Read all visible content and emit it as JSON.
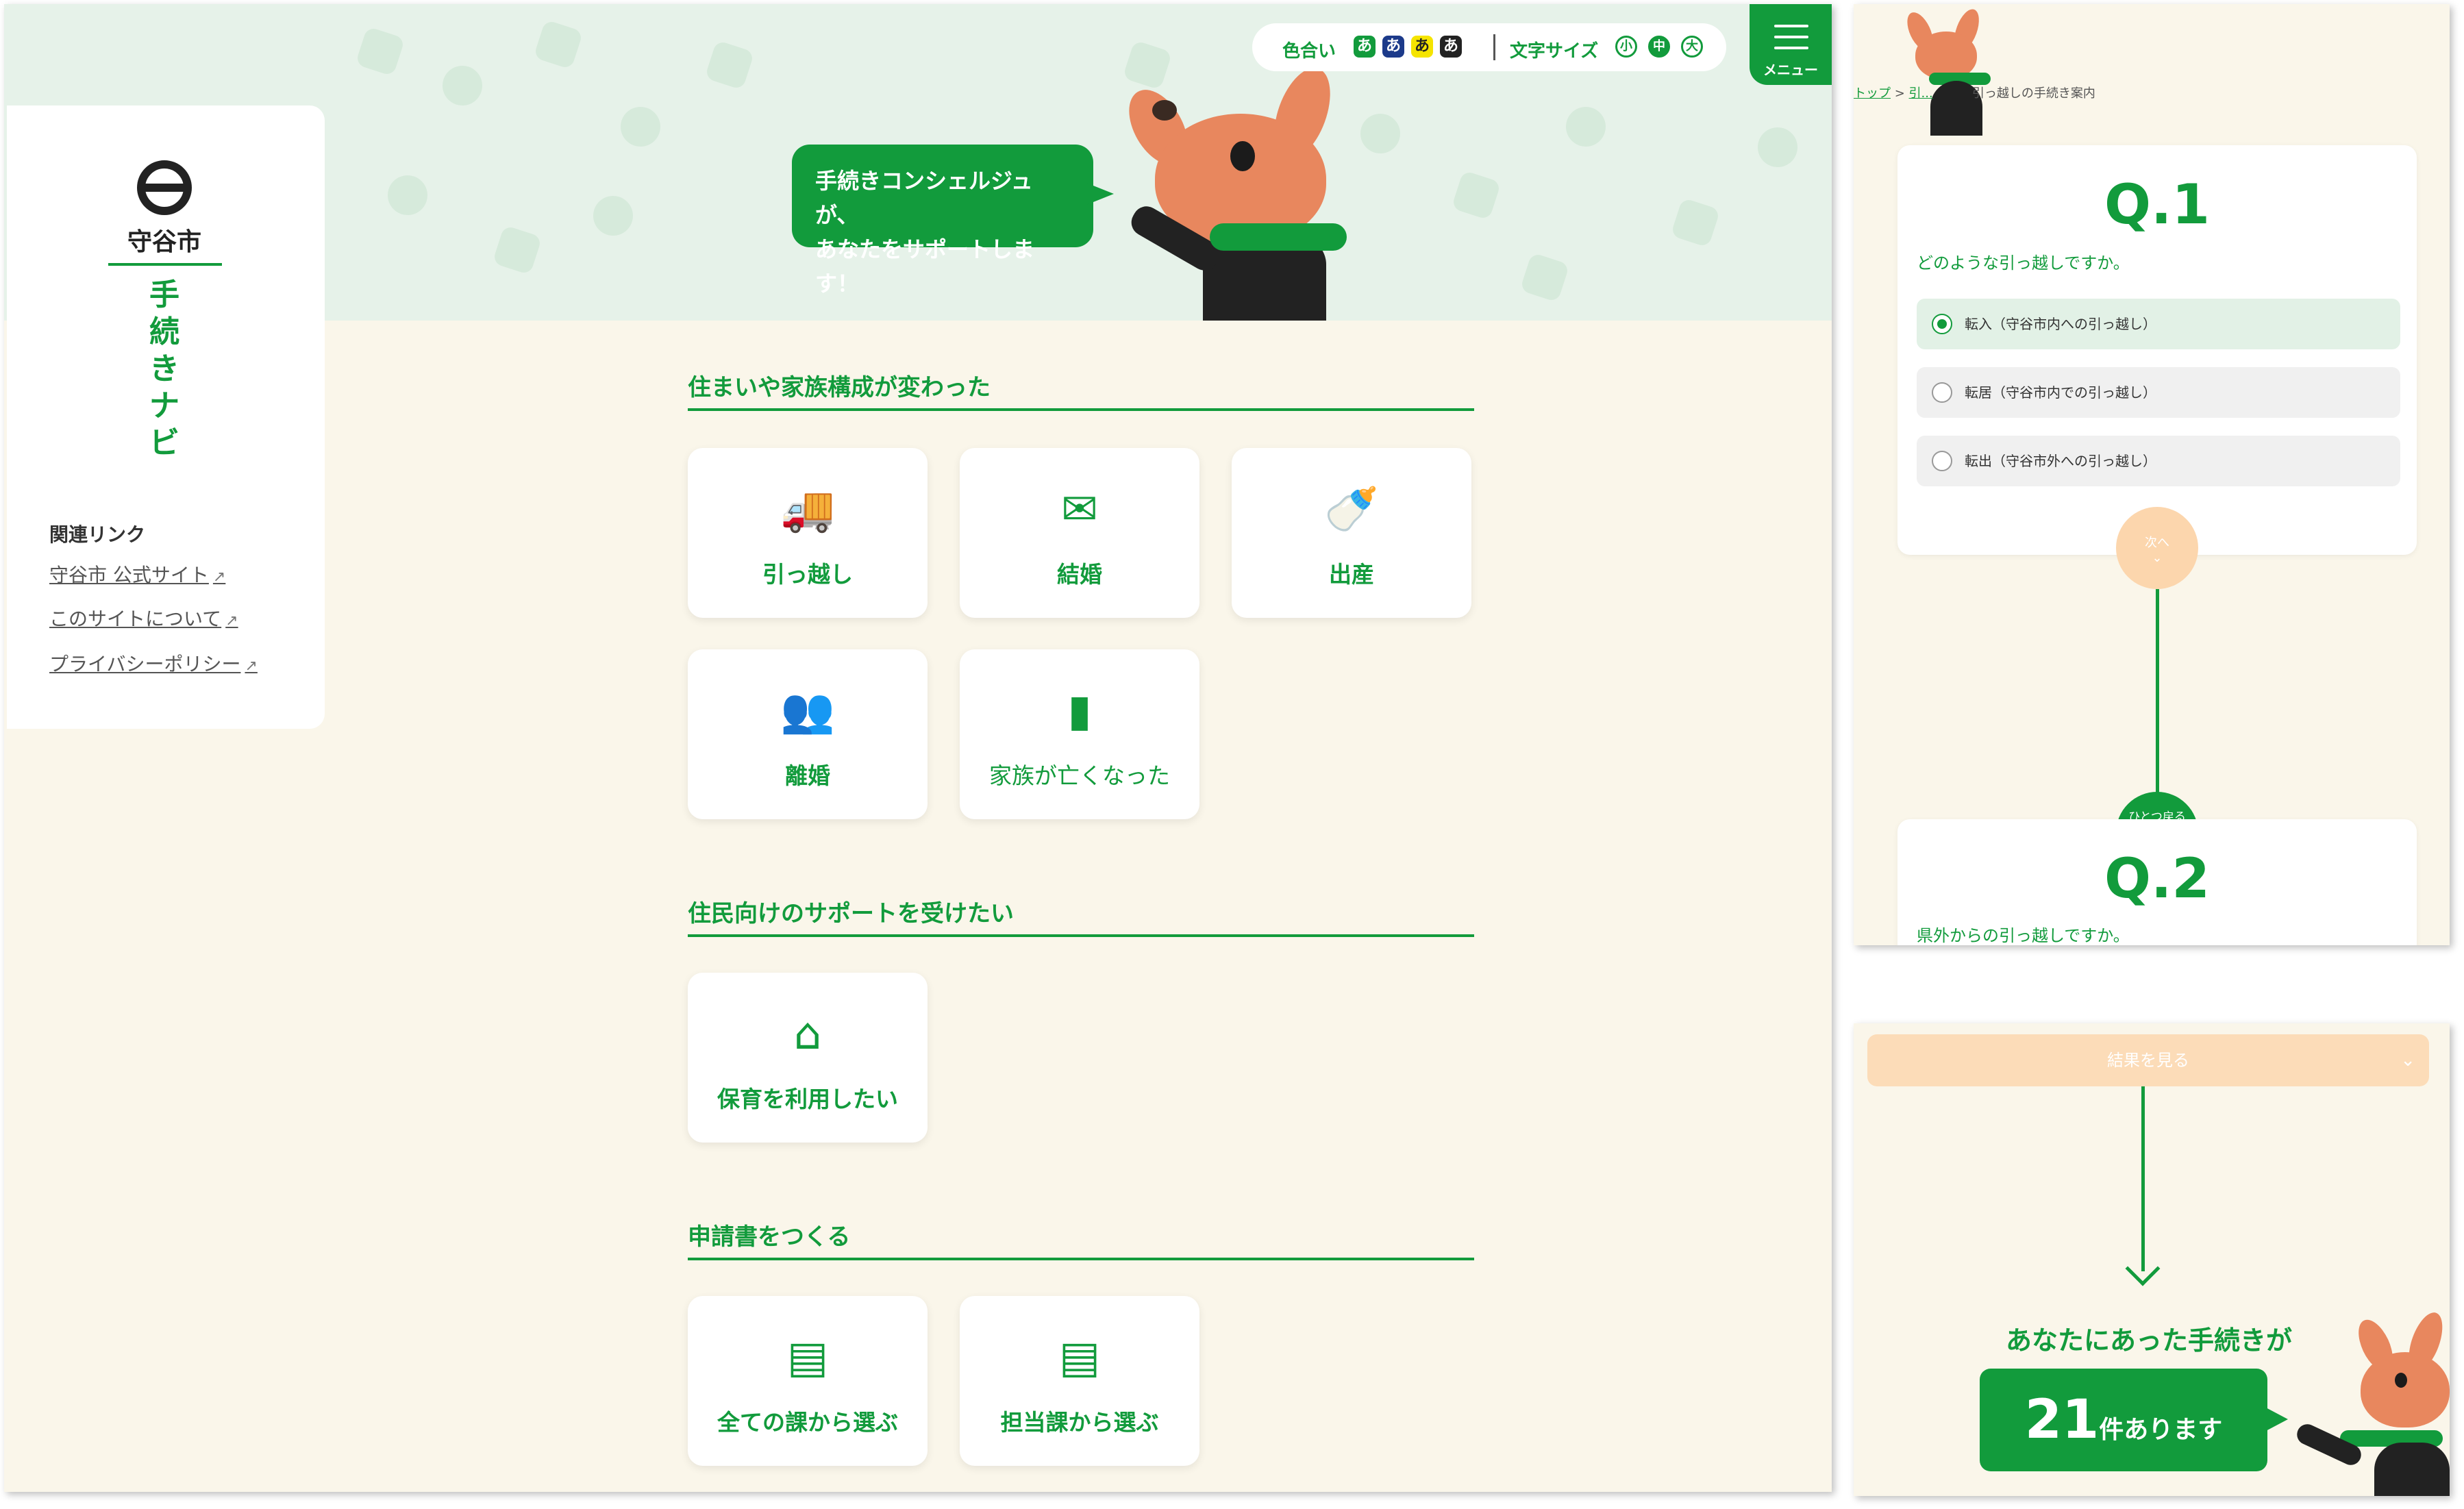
{
  "colors": {
    "brand_green": "#129b3c",
    "cream": "#faf6ea",
    "hero_green": "#e6f2e9",
    "peach": "#fcd6ad"
  },
  "toolbar": {
    "color_label": "色合い",
    "color_swatches": [
      "あ",
      "あ",
      "あ",
      "あ"
    ],
    "size_label": "文字サイズ",
    "sizes": [
      "小",
      "中",
      "大"
    ],
    "menu_label": "メニュー"
  },
  "sidebar": {
    "logo_text": "守谷市",
    "site_title": "手\n続\nき\nナ\nビ",
    "links_heading": "関連リンク",
    "links": [
      "守谷市 公式サイト",
      "このサイトについて",
      "プライバシーポリシー"
    ]
  },
  "hero": {
    "bubble_line1": "手続きコンシェルジュが、",
    "bubble_line2": "あなたをサポートします！"
  },
  "sections": [
    {
      "heading": "住まいや家族構成が変わった",
      "cards": [
        {
          "label": "引っ越し",
          "icon": "truck-icon"
        },
        {
          "label": "結婚",
          "icon": "heart-envelope-icon"
        },
        {
          "label": "出産",
          "icon": "baby-bottle-icon"
        },
        {
          "label": "離婚",
          "icon": "divorce-icon"
        },
        {
          "label": "家族が亡くなった",
          "icon": "memorial-icon"
        }
      ]
    },
    {
      "heading": "住民向けのサポートを受けたい",
      "cards": [
        {
          "label": "保育を利用したい",
          "icon": "childcare-icon"
        }
      ]
    },
    {
      "heading": "申請書をつくる",
      "cards": [
        {
          "label": "全ての課から選ぶ",
          "icon": "document-add-icon"
        },
        {
          "label": "担当課から選ぶ",
          "icon": "document-add-icon"
        }
      ]
    }
  ],
  "wizard": {
    "breadcrumb": [
      "トップ",
      "引...",
      "引っ越しの手続き案内"
    ],
    "q1": {
      "number": "Q.1",
      "text": "どのような引っ越しですか。",
      "options": [
        "転入（守谷市内への引っ越し）",
        "転居（守谷市内での引っ越し）",
        "転出（守谷市外への引っ越し）"
      ],
      "selected": 0
    },
    "next_label": "次へ",
    "back_label": "ひとつ戻る",
    "q2": {
      "number": "Q.2",
      "text": "県外からの引っ越しですか。"
    }
  },
  "result": {
    "button_label": "結果を見る",
    "lead": "あなたにあった手続きが",
    "count": "21",
    "count_suffix": "件あります"
  }
}
